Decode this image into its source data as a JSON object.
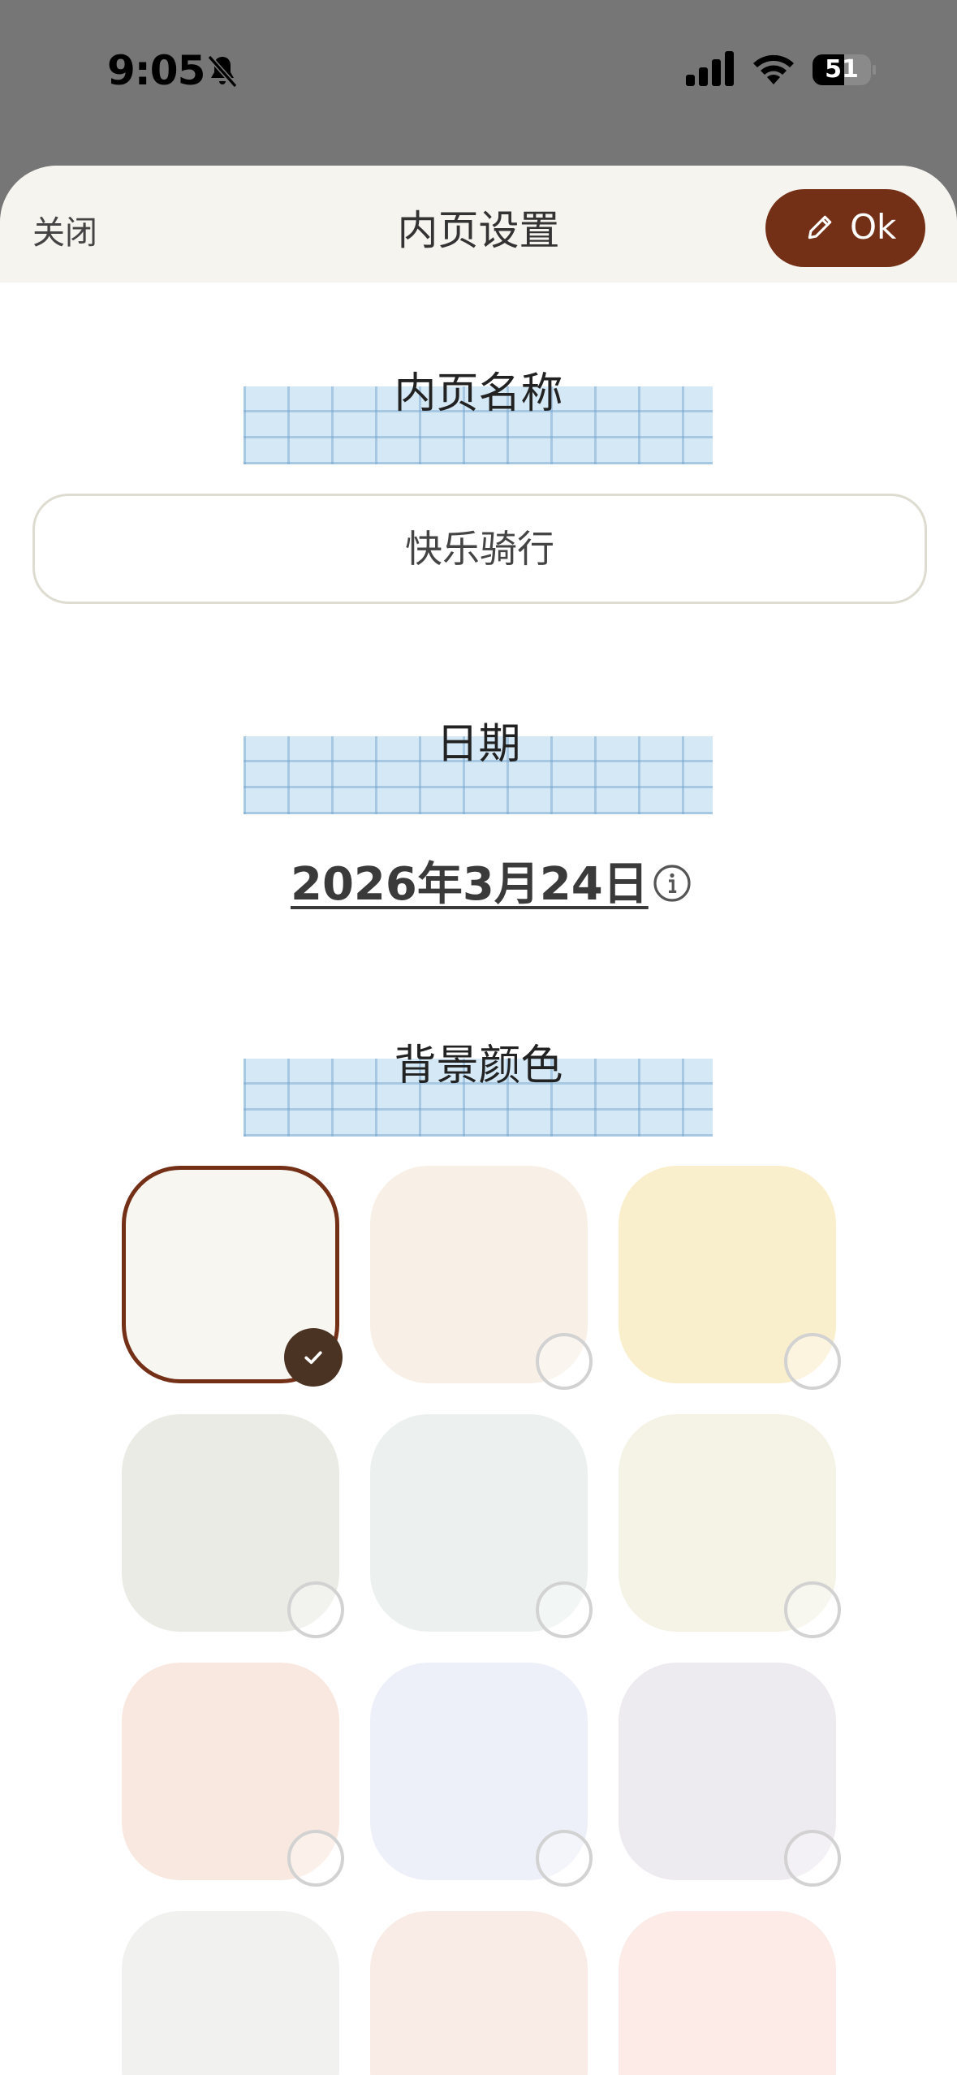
{
  "status_bar": {
    "time": "9:05",
    "battery": "51"
  },
  "header": {
    "close_label": "关闭",
    "title": "内页设置",
    "ok_label": "Ok"
  },
  "page_name": {
    "section_label": "内页名称",
    "value": "快乐骑行"
  },
  "date": {
    "section_label": "日期",
    "value": "2026年3月24日"
  },
  "background_color": {
    "section_label": "背景颜色",
    "selected_index": 0,
    "swatches": [
      "#f7f6f1",
      "#f8f0e6",
      "#faefcc",
      "#ebebe6",
      "#ecf1f0",
      "#f5f3e6",
      "#f9e8df",
      "#edf0f8",
      "#edeaf0",
      "#f1f1f0",
      "#f9ece7",
      "#fcebe7"
    ]
  },
  "colors": {
    "accent": "#743017",
    "tape": "#d4e8f5",
    "sheet_header": "#f6f4ef"
  },
  "icons": [
    "bell-slash-icon",
    "cellular-signal-icon",
    "wifi-icon",
    "battery-icon",
    "pencil-icon",
    "info-icon",
    "checkmark-icon"
  ]
}
